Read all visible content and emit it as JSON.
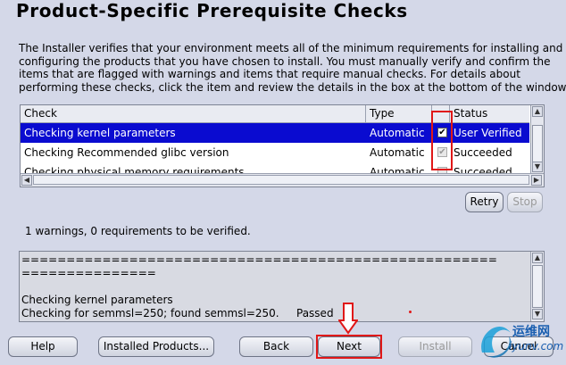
{
  "page_title": "Product-Specific Prerequisite Checks",
  "description_lines": [
    "The Installer verifies that your environment meets all of the minimum requirements for installing and",
    "configuring the products that you have chosen to install. You must manually verify and confirm the",
    "items that are flagged with warnings and items that require manual checks. For details about",
    "performing these checks, click the item and review the details in the box at the bottom of the window."
  ],
  "table": {
    "headers": {
      "check": "Check",
      "type": "Type",
      "status": "Status"
    },
    "rows": [
      {
        "check": "Checking kernel parameters",
        "type": "Automatic",
        "checked": true,
        "status": "User Verified"
      },
      {
        "check": "Checking Recommended glibc version",
        "type": "Automatic",
        "checked": true,
        "status": "Succeeded"
      },
      {
        "check": "Checking physical memory requirements",
        "type": "Automatic",
        "checked": false,
        "status": "Succeeded"
      }
    ]
  },
  "buttons": {
    "retry": "Retry",
    "stop": "Stop",
    "help": "Help",
    "installed_products": "Installed Products...",
    "back": "Back",
    "next": "Next",
    "install": "Install",
    "cancel": "Cancel"
  },
  "summary_text": "1 warnings, 0 requirements to be verified.",
  "details": {
    "separator1": "=====================================================",
    "separator2": "===============",
    "line1": "Checking kernel parameters",
    "line2": "Checking for semmsl=250; found semmsl=250.",
    "line2_status": "Passed"
  },
  "watermark": {
    "text_cn": "运维网",
    "text_en": "iyunv.com"
  },
  "colors": {
    "selection": "#0a0bd0",
    "highlight": "#e01818",
    "background": "#d4d8e8"
  }
}
